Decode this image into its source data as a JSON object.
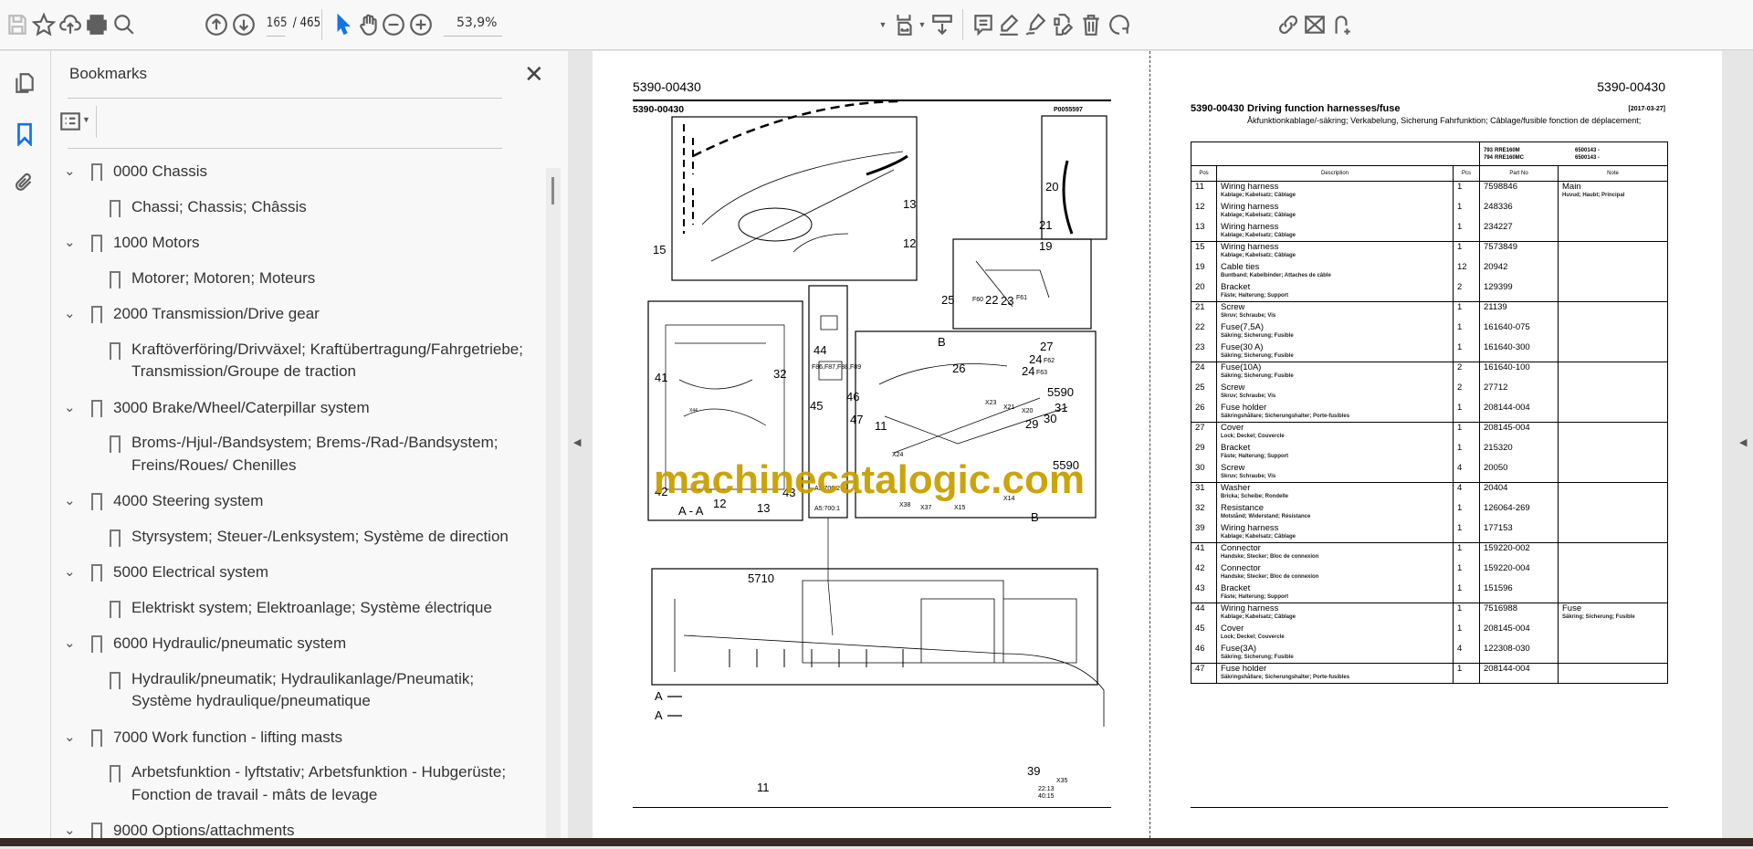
{
  "toolbar": {
    "page_current": "165",
    "page_total": "/ 465",
    "zoom": "53,9%"
  },
  "sidebar": {
    "title": "Bookmarks",
    "bookmarks": [
      {
        "label": "0000 Chassis",
        "children": [
          "Chassi; Chassis; Châssis"
        ]
      },
      {
        "label": "1000 Motors",
        "children": [
          "Motorer; Motoren; Moteurs"
        ]
      },
      {
        "label": "2000 Transmission/Drive gear",
        "children": [
          "Kraftöverföring/Drivväxel; Kraftübertragung/Fahrgetriebe; Transmission/Groupe de traction"
        ]
      },
      {
        "label": "3000 Brake/Wheel/Caterpillar system",
        "children": [
          "Broms-/Hjul-/Bandsystem; Brems-/Rad-/Bandsystem; Freins/Roues/ Chenilles"
        ]
      },
      {
        "label": "4000 Steering system",
        "children": [
          "Styrsystem; Steuer-/Lenksystem; Système de direction"
        ]
      },
      {
        "label": "5000 Electrical system",
        "children": [
          "Elektriskt system; Elektroanlage; Système électrique"
        ]
      },
      {
        "label": "6000 Hydraulic/pneumatic system",
        "children": [
          "Hydraulik/pneumatik; Hydraulikanlage/Pneumatik; Système hydraulique/pneumatique"
        ]
      },
      {
        "label": "7000 Work function - lifting masts",
        "children": [
          "Arbetsfunktion - lyftstativ; Arbetsfunktion - Hubgerüste; Fonction de travail - mâts de levage"
        ]
      },
      {
        "label": "9000 Options/attachments",
        "children": []
      }
    ]
  },
  "page1": {
    "header": "5390-00430",
    "subheader": "5390-00430",
    "image_id": "P0055597",
    "watermark": "machinecatalogic.com",
    "callouts": [
      "15",
      "13",
      "12",
      "20",
      "21",
      "19",
      "25",
      "F60",
      "22",
      "23",
      "F61",
      "B",
      "27",
      "24",
      "F62",
      "44",
      "F86,F87,F88,F89",
      "45",
      "46",
      "47",
      "41",
      "32",
      "42",
      "43",
      "12",
      "13",
      "A - A",
      "26",
      "24",
      "F63",
      "5590",
      "X23",
      "X21",
      "X20",
      "29",
      "30",
      "31",
      "11",
      "X24",
      "5590",
      "X38",
      "X37",
      "X15",
      "X14",
      "B",
      "A5:700:1",
      "5710",
      "11",
      "A",
      "A",
      "39",
      "X35",
      "22:13",
      "40:15",
      "X44",
      "A5:700:2"
    ]
  },
  "page2": {
    "header": "5390-00430",
    "code": "5390-00430",
    "title": "Driving function harnesses/fuse",
    "date": "[2017-03-27]",
    "subtitle": "Åkfunktionkablage/-säkring; Verkabelung, Sicherung Fahrfunktion; Câblage/fusible fonction de déplacement;",
    "models": [
      {
        "n": "793",
        "m": "RRE160M",
        "s": "6500143 -"
      },
      {
        "n": "794",
        "m": "RRE160MC",
        "s": "6500143 -"
      }
    ],
    "columns": [
      "Pos",
      "Description",
      "Pcs",
      "Part No",
      "Note"
    ],
    "groups": [
      [
        {
          "pos": "11",
          "desc": "Wiring harness",
          "tr": "Kablage; Kabelsatz; Câblage",
          "pcs": "1",
          "part": "7598846",
          "note": "Main",
          "note_tr": "Huvud; Haubt; Principal"
        },
        {
          "pos": "12",
          "desc": "Wiring harness",
          "tr": "Kablage; Kabelsatz; Câblage",
          "pcs": "1",
          "part": "248336"
        },
        {
          "pos": "13",
          "desc": "Wiring harness",
          "tr": "Kablage; Kabelsatz; Câblage",
          "pcs": "1",
          "part": "234227"
        }
      ],
      [
        {
          "pos": "15",
          "desc": "Wiring harness",
          "tr": "Kablage; Kabelsatz; Câblage",
          "pcs": "1",
          "part": "7573849"
        },
        {
          "pos": "19",
          "desc": "Cable ties",
          "tr": "Buntband; Kabelbinder; Attaches de câble",
          "pcs": "12",
          "part": "20942"
        },
        {
          "pos": "20",
          "desc": "Bracket",
          "tr": "Fäste; Halterung; Support",
          "pcs": "2",
          "part": "129399"
        }
      ],
      [
        {
          "pos": "21",
          "desc": "Screw",
          "tr": "Skruv; Schraube; Vis",
          "pcs": "1",
          "part": "21139"
        },
        {
          "pos": "22",
          "desc": "Fuse(7,5A)",
          "tr": "Säkring; Sicherung; Fusible",
          "pcs": "1",
          "part": "161640-075"
        },
        {
          "pos": "23",
          "desc": "Fuse(30 A)",
          "tr": "Säkring; Sicherung; Fusible",
          "pcs": "1",
          "part": "161640-300"
        }
      ],
      [
        {
          "pos": "24",
          "desc": "Fuse(10A)",
          "tr": "Säkring; Sicherung; Fusible",
          "pcs": "2",
          "part": "161640-100"
        },
        {
          "pos": "25",
          "desc": "Screw",
          "tr": "Skruv; Schraube; Vis",
          "pcs": "2",
          "part": "27712"
        },
        {
          "pos": "26",
          "desc": "Fuse holder",
          "tr": "Säkringshållare; Sicherungshalter; Porte-fusibles",
          "pcs": "1",
          "part": "208144-004"
        }
      ],
      [
        {
          "pos": "27",
          "desc": "Cover",
          "tr": "Lock; Deckel; Couvercle",
          "pcs": "1",
          "part": "208145-004"
        },
        {
          "pos": "29",
          "desc": "Bracket",
          "tr": "Fäste; Halterung; Support",
          "pcs": "1",
          "part": "215320"
        },
        {
          "pos": "30",
          "desc": "Screw",
          "tr": "Skruv; Schraube; Vis",
          "pcs": "4",
          "part": "20050"
        }
      ],
      [
        {
          "pos": "31",
          "desc": "Washer",
          "tr": "Bricka; Scheibe; Rondelle",
          "pcs": "4",
          "part": "20404"
        },
        {
          "pos": "32",
          "desc": "Resistance",
          "tr": "Motstånd; Widerstand; Résistance",
          "pcs": "1",
          "part": "126064-269"
        },
        {
          "pos": "39",
          "desc": "Wiring harness",
          "tr": "Kablage; Kabelsatz; Câblage",
          "pcs": "1",
          "part": "177153"
        }
      ],
      [
        {
          "pos": "41",
          "desc": "Connector",
          "tr": "Handske; Stecker; Bloc de connexion",
          "pcs": "1",
          "part": "159220-002"
        },
        {
          "pos": "42",
          "desc": "Connector",
          "tr": "Handske; Stecker; Bloc de connexion",
          "pcs": "1",
          "part": "159220-004"
        },
        {
          "pos": "43",
          "desc": "Bracket",
          "tr": "Fäste; Halterung; Support",
          "pcs": "1",
          "part": "151596"
        }
      ],
      [
        {
          "pos": "44",
          "desc": "Wiring harness",
          "tr": "Kablage; Kabelsatz; Câblage",
          "pcs": "1",
          "part": "7516988",
          "note": "Fuse",
          "note_tr": "Säkring; Sicherung; Fusible"
        },
        {
          "pos": "45",
          "desc": "Cover",
          "tr": "Lock; Deckel; Couvercle",
          "pcs": "1",
          "part": "208145-004"
        },
        {
          "pos": "46",
          "desc": "Fuse(3A)",
          "tr": "Säkring; Sicherung; Fusible",
          "pcs": "4",
          "part": "122308-030"
        }
      ],
      [
        {
          "pos": "47",
          "desc": "Fuse holder",
          "tr": "Säkringshållare; Sicherungshalter; Porte-fusibles",
          "pcs": "1",
          "part": "208144-004"
        }
      ]
    ]
  },
  "colors": {
    "accent": "#1473e6",
    "watermark": "#c9a000"
  }
}
